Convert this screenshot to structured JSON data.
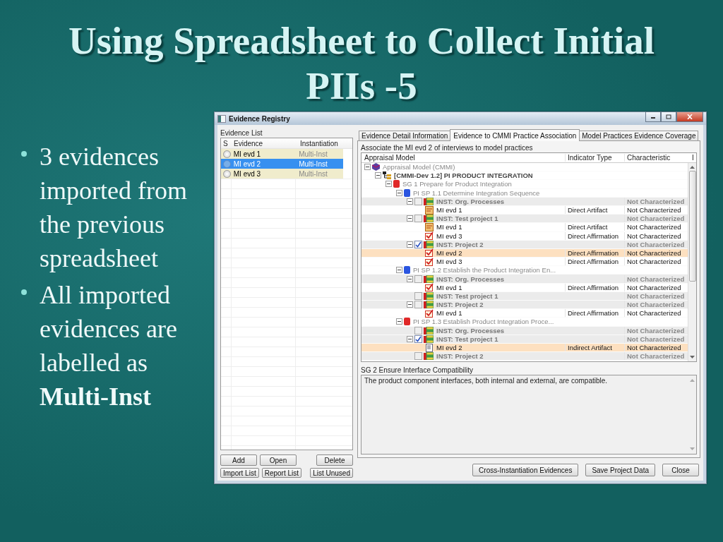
{
  "slide": {
    "title": "Using Spreadsheet to Collect Initial PIIs -5",
    "bullets": [
      "3 evidences imported from the previous spreadsheet",
      "All imported evidences are labelled as **Multi-Inst**"
    ]
  },
  "window": {
    "title": "Evidence Registry"
  },
  "evidence_list": {
    "label": "Evidence List",
    "columns": [
      "S",
      "Evidence",
      "Instantiation"
    ],
    "rows": [
      {
        "evidence": "MI evd 1",
        "instantiation": "Multi-Inst",
        "selected": false
      },
      {
        "evidence": "MI evd 2",
        "instantiation": "Multi-Inst",
        "selected": true
      },
      {
        "evidence": "MI evd 3",
        "instantiation": "Multi-Inst",
        "selected": false
      }
    ],
    "buttons": [
      "Add",
      "Open",
      "Delete"
    ],
    "buttons_2": [
      "Import List",
      "Report List",
      "List Unused"
    ]
  },
  "tabs": [
    {
      "label": "Evidence Detail Information",
      "selected": false
    },
    {
      "label": "Evidence to CMMI Practice Association",
      "selected": true
    },
    {
      "label": "Model Practices Evidence Coverage",
      "selected": false
    }
  ],
  "association": {
    "caption": "Associate the MI evd 2 of interviews to model practices",
    "columns": [
      "Appraisal Model",
      "Indicator Type",
      "Characteristic",
      "I"
    ],
    "rows": [
      {
        "kind": "model",
        "label": "Appraisal Model (CMMI)",
        "selected": false,
        "children": [
          {
            "kind": "area",
            "label": "[CMMI-Dev 1.2] PI PRODUCT INTEGRATION",
            "selected": false,
            "children": [
              {
                "kind": "goal",
                "label": "SG 1 Prepare for Product Integration",
                "color": "#e02828",
                "selected": false,
                "children": [
                  {
                    "kind": "practice",
                    "label": "PI SP 1.1 Determine Integration Sequence",
                    "color": "#2a55e0",
                    "selected": false,
                    "children": [
                      {
                        "kind": "inst",
                        "label": "INST: Org. Processes",
                        "checked": false,
                        "characteristic": "Not Characterized",
                        "selected": false,
                        "children": [
                          {
                            "kind": "artifact",
                            "label": "MI evd 1",
                            "indicator_type": "Direct Artifact",
                            "characteristic": "Not Characterized",
                            "selected": false
                          }
                        ]
                      },
                      {
                        "kind": "inst",
                        "label": "INST:  Test project 1",
                        "checked": false,
                        "characteristic": "Not Characterized",
                        "selected": false,
                        "children": [
                          {
                            "kind": "artifact",
                            "label": "MI evd 1",
                            "indicator_type": "Direct Artifact",
                            "characteristic": "Not Characterized",
                            "selected": false
                          },
                          {
                            "kind": "affirmation",
                            "label": "MI evd 3",
                            "indicator_type": "Direct Affirmation",
                            "characteristic": "Not Characterized",
                            "selected": false
                          }
                        ]
                      },
                      {
                        "kind": "inst",
                        "label": "INST: Project 2",
                        "checked": true,
                        "characteristic": "Not Characterized",
                        "selected": false,
                        "children": [
                          {
                            "kind": "affirmation",
                            "label": "MI evd 2",
                            "indicator_type": "Direct Affirmation",
                            "characteristic": "Not Characterized",
                            "selected": true
                          },
                          {
                            "kind": "affirmation",
                            "label": "MI evd 3",
                            "indicator_type": "Direct Affirmation",
                            "characteristic": "Not Characterized",
                            "selected": false
                          }
                        ]
                      }
                    ]
                  },
                  {
                    "kind": "practice",
                    "label": "PI SP 1.2 Establish the Product Integration En...",
                    "color": "#2a55e0",
                    "selected": false,
                    "children": [
                      {
                        "kind": "inst",
                        "label": "INST: Org. Processes",
                        "checked": false,
                        "characteristic": "Not Characterized",
                        "selected": false,
                        "children": [
                          {
                            "kind": "affirmation",
                            "label": "MI evd 1",
                            "indicator_type": "Direct Affirmation",
                            "characteristic": "Not Characterized",
                            "selected": false
                          }
                        ]
                      },
                      {
                        "kind": "inst",
                        "label": "INST:  Test project 1",
                        "checked": false,
                        "characteristic": "Not Characterized",
                        "selected": false
                      },
                      {
                        "kind": "inst",
                        "label": "INST: Project 2",
                        "checked": false,
                        "characteristic": "Not Characterized",
                        "selected": false,
                        "children": [
                          {
                            "kind": "affirmation",
                            "label": "MI evd 1",
                            "indicator_type": "Direct Affirmation",
                            "characteristic": "Not Characterized",
                            "selected": false
                          }
                        ]
                      }
                    ]
                  },
                  {
                    "kind": "practice",
                    "label": "PI SP 1.3 Establish Product Integration Proce...",
                    "color": "#e02828",
                    "selected": false,
                    "children": [
                      {
                        "kind": "inst",
                        "label": "INST: Org. Processes",
                        "checked": false,
                        "characteristic": "Not Characterized",
                        "selected": false
                      },
                      {
                        "kind": "inst",
                        "label": "INST:  Test project 1",
                        "checked": true,
                        "characteristic": "Not Characterized",
                        "selected": false,
                        "children": [
                          {
                            "kind": "indirect",
                            "label": "MI evd 2",
                            "indicator_type": "Indirect Artifact",
                            "characteristic": "Not Characterized",
                            "selected": true
                          }
                        ]
                      },
                      {
                        "kind": "inst",
                        "label": "INST: Project 2",
                        "checked": false,
                        "characteristic": "Not Characterized",
                        "selected": false
                      }
                    ]
                  }
                ]
              }
            ]
          }
        ]
      }
    ]
  },
  "description": {
    "label": "SG 2 Ensure Interface Compatibility",
    "text": "The product component interfaces, both internal and external, are compatible."
  },
  "footer_buttons": [
    "Cross-Instantiation Evidences",
    "Save Project Data",
    "Close"
  ]
}
